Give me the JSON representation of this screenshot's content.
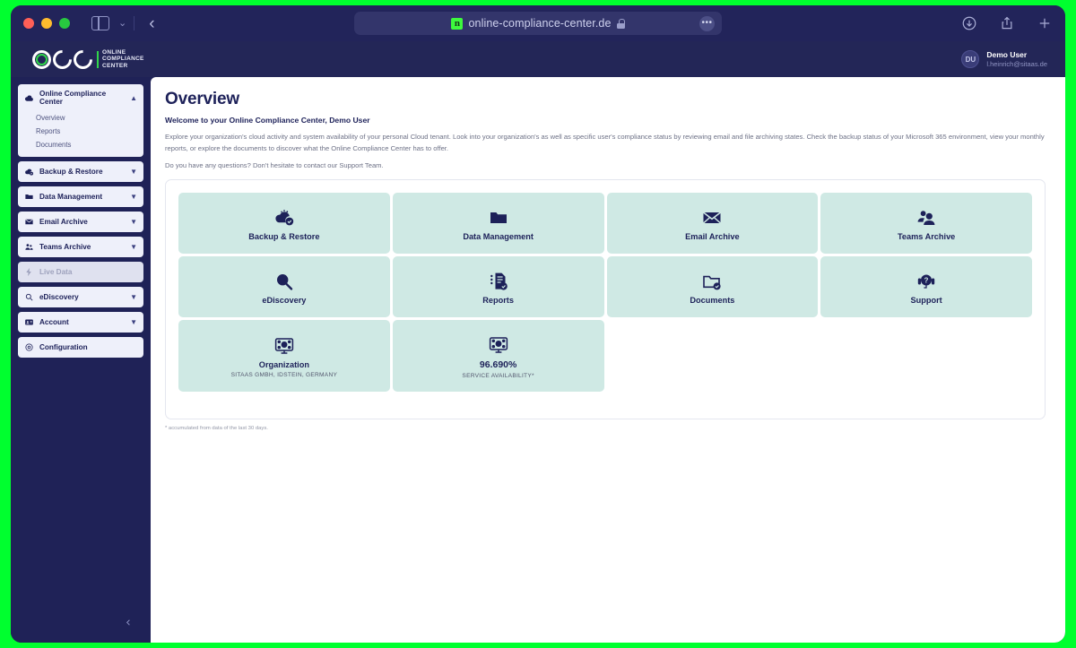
{
  "browser": {
    "url": "online-compliance-center.de",
    "favicon_letter": "n",
    "favicon_color": "#3dfa3d",
    "lock_icon": "lock-icon",
    "more_label": "•••",
    "sidebar_toggle_icon": "sidebar-toggle-icon",
    "tab_chevron_icon": "chevron-down-icon",
    "back_icon": "back-chevron-icon",
    "download_icon": "download-icon",
    "share_icon": "share-icon",
    "new_tab_icon": "plus-icon"
  },
  "header": {
    "logo_mark": "OCC",
    "logo_line1": "ONLINE",
    "logo_line2": "COMPLIANCE",
    "logo_line3": "CENTER",
    "user": {
      "initials": "DU",
      "name": "Demo User",
      "email": "l.heinrich@sitaas.de"
    }
  },
  "sidebar": {
    "collapse_icon": "chevron-left-icon",
    "groups": [
      {
        "label": "Online Compliance Center",
        "icon": "cloud-icon",
        "chevron": "▲",
        "expanded": true,
        "disabled": false,
        "items": [
          {
            "label": "Overview"
          },
          {
            "label": "Reports"
          },
          {
            "label": "Documents"
          }
        ]
      },
      {
        "label": "Backup & Restore",
        "icon": "cloud-check-icon",
        "chevron": "▼",
        "expanded": false,
        "disabled": false,
        "items": []
      },
      {
        "label": "Data Management",
        "icon": "folder-icon",
        "chevron": "▼",
        "expanded": false,
        "disabled": false,
        "items": []
      },
      {
        "label": "Email Archive",
        "icon": "envelope-icon",
        "chevron": "▼",
        "expanded": false,
        "disabled": false,
        "items": []
      },
      {
        "label": "Teams Archive",
        "icon": "people-icon",
        "chevron": "▼",
        "expanded": false,
        "disabled": false,
        "items": []
      },
      {
        "label": "Live Data",
        "icon": "bolt-icon",
        "chevron": "",
        "expanded": false,
        "disabled": true,
        "items": []
      },
      {
        "label": "eDiscovery",
        "icon": "magnifier-icon",
        "chevron": "▼",
        "expanded": false,
        "disabled": false,
        "items": []
      },
      {
        "label": "Account",
        "icon": "id-card-icon",
        "chevron": "▼",
        "expanded": false,
        "disabled": false,
        "items": []
      },
      {
        "label": "Configuration",
        "icon": "gear-icon",
        "chevron": "",
        "expanded": false,
        "disabled": false,
        "items": []
      }
    ]
  },
  "main": {
    "title": "Overview",
    "welcome": "Welcome to your Online Compliance Center, Demo User",
    "intro": "Explore your organization's cloud activity and system availability of your personal Cloud tenant. Look into your organization's as well as specific user's compliance status by reviewing email and file archiving states. Check the backup status of your Microsoft 365 environment, view your monthly reports, or explore the documents to discover what the Online Compliance Center has to offer.",
    "support_line": "Do you have any questions? Don't hesitate to contact our Support Team.",
    "footnote": "* accumulated from data of the last 30 days.",
    "tiles": [
      {
        "label": "Backup & Restore",
        "sub": "",
        "icon": "cloud-check-icon"
      },
      {
        "label": "Data Management",
        "sub": "",
        "icon": "folder-icon"
      },
      {
        "label": "Email Archive",
        "sub": "",
        "icon": "envelope-icon"
      },
      {
        "label": "Teams Archive",
        "sub": "",
        "icon": "people-icon"
      },
      {
        "label": "eDiscovery",
        "sub": "",
        "icon": "magnifier-icon"
      },
      {
        "label": "Reports",
        "sub": "",
        "icon": "report-check-icon"
      },
      {
        "label": "Documents",
        "sub": "",
        "icon": "folder-check-icon"
      },
      {
        "label": "Support",
        "sub": "",
        "icon": "headset-icon"
      },
      {
        "label": "Organization",
        "sub": "SITAAS GMBH, IDSTEIN, GERMANY",
        "icon": "monitor-network-icon"
      },
      {
        "label": "96.690%",
        "sub": "SERVICE AVAILABILITY*",
        "icon": "monitor-network-icon"
      }
    ]
  },
  "colors": {
    "window_bg": "#1f2257",
    "tile_bg": "#cfe9e4",
    "brand_navy": "#1d2159",
    "brand_green": "#31d64a",
    "desktop": "#00ff2f"
  }
}
